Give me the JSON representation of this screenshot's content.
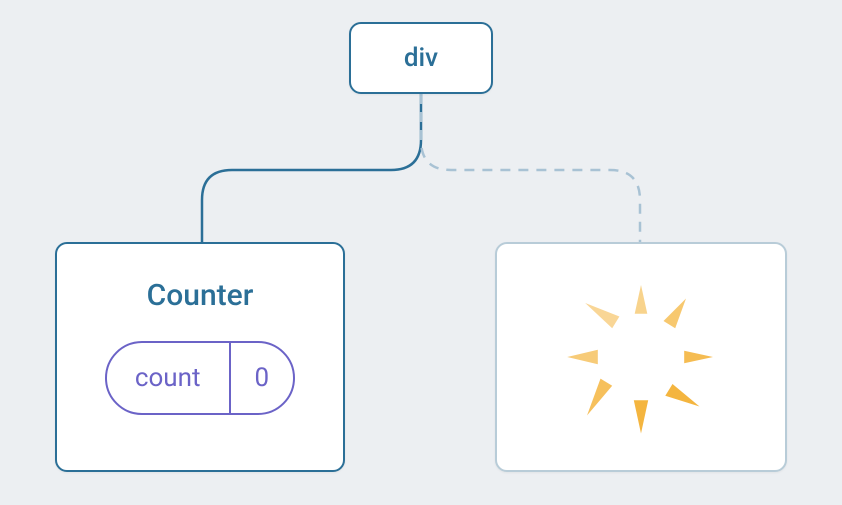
{
  "root": {
    "label": "div"
  },
  "counter": {
    "title": "Counter",
    "state": {
      "key": "count",
      "value": "0"
    }
  },
  "colors": {
    "bg": "#eceff2",
    "nodeBorder": "#2b6f97",
    "nodeText": "#2b6f97",
    "placeholderBorder": "#b8ccd8",
    "pill": "#6b63c7",
    "spinner": "#f4b53f",
    "connectorSolid": "#2b6f97",
    "connectorDashed": "#a8c2d4"
  }
}
